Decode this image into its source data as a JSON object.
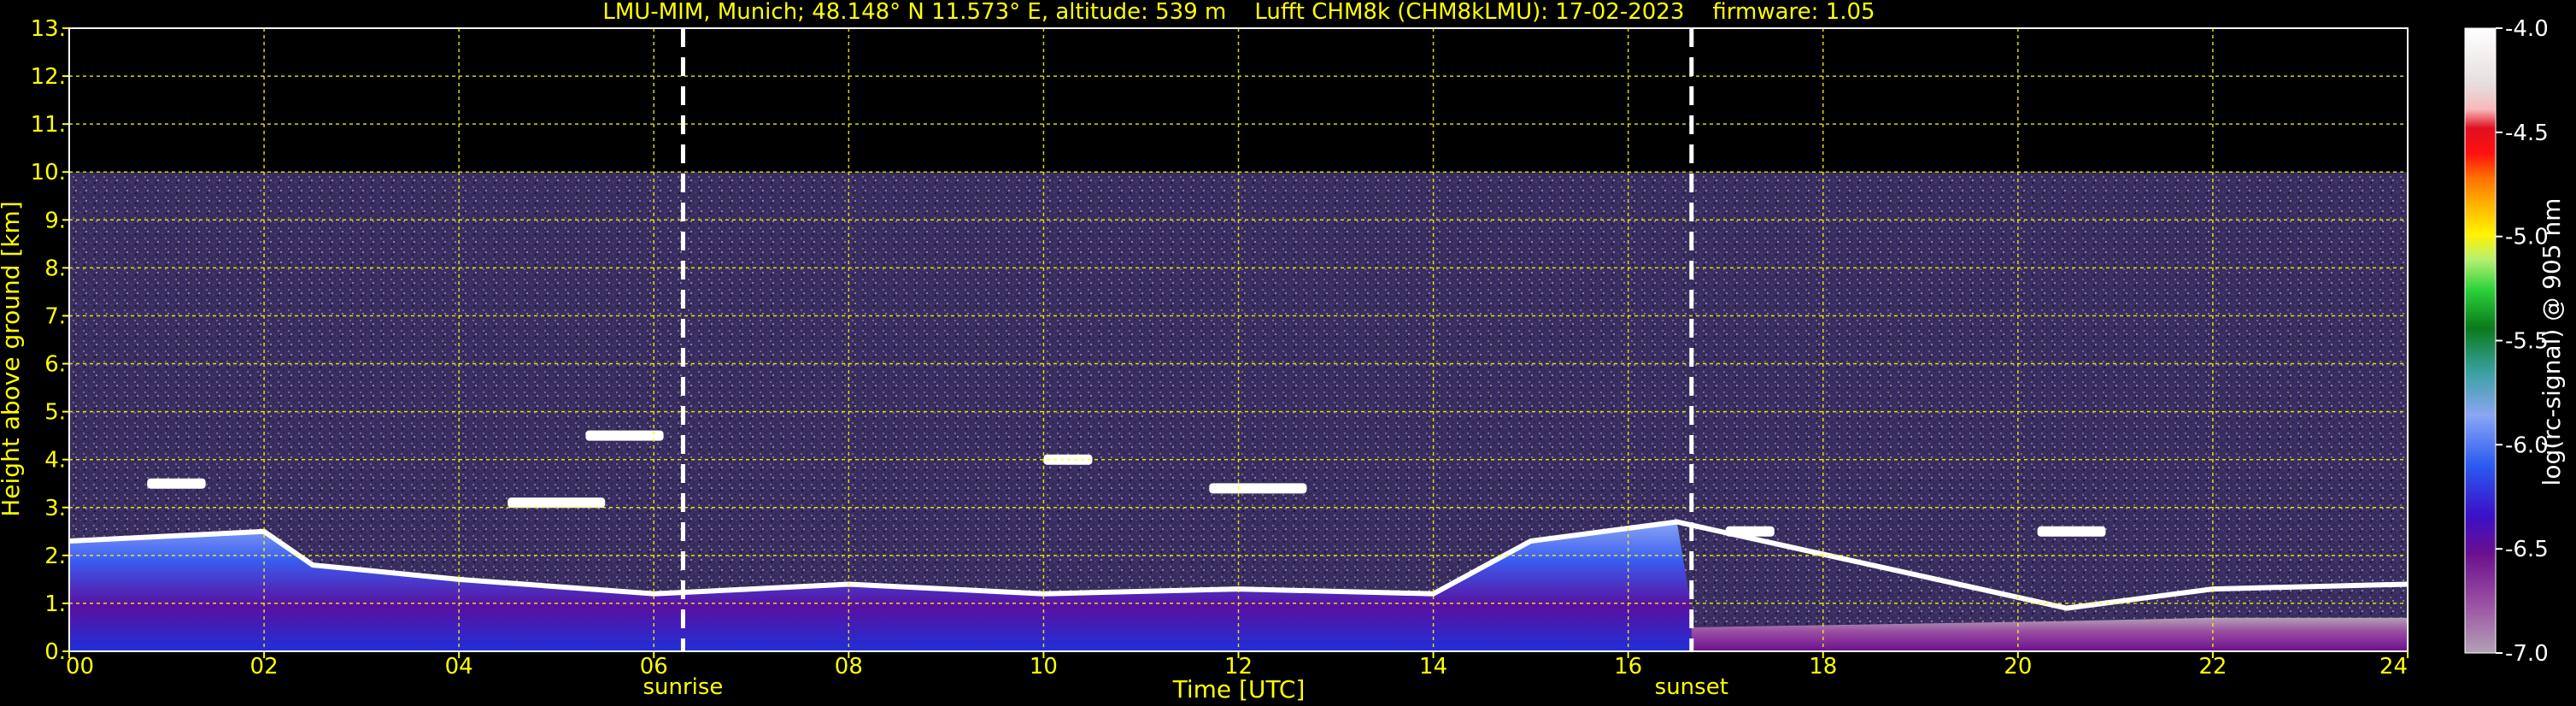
{
  "chart_data": {
    "type": "heatmap",
    "title": "LMU-MIM, Munich; 48.148° N 11.573° E, altitude: 539 m    Lufft CHM8k (CHM8kLMU): 17-02-2023    firmware: 1.05",
    "xlabel": "Time [UTC]",
    "ylabel": "Height above ground [km]",
    "xlim": [
      0,
      24
    ],
    "ylim": [
      0,
      13
    ],
    "x_ticks": [
      "00",
      "02",
      "04",
      "06",
      "08",
      "10",
      "12",
      "14",
      "16",
      "18",
      "20",
      "22",
      "24"
    ],
    "y_ticks": [
      "0.",
      "1.",
      "2.",
      "3.",
      "4.",
      "5.",
      "6.",
      "7.",
      "8.",
      "9.",
      "10.",
      "11.",
      "12.",
      "13."
    ],
    "grid": true,
    "measurement_top_km": 10,
    "markers": [
      {
        "label": "sunrise",
        "time": 6.3
      },
      {
        "label": "sunset",
        "time": 16.65
      }
    ],
    "colorbar": {
      "label": "log(rc-signal) @ 905 nm",
      "range": [
        -7.0,
        -4.0
      ],
      "ticks": [
        "-4.0",
        "-4.5",
        "-5.0",
        "-5.5",
        "-6.0",
        "-6.5",
        "-7.0"
      ]
    },
    "boundary_layer_top_km": [
      {
        "time": 0.0,
        "height": 2.3
      },
      {
        "time": 1.0,
        "height": 2.4
      },
      {
        "time": 2.0,
        "height": 2.5
      },
      {
        "time": 2.5,
        "height": 1.8
      },
      {
        "time": 4.0,
        "height": 1.5
      },
      {
        "time": 6.0,
        "height": 1.2
      },
      {
        "time": 8.0,
        "height": 1.4
      },
      {
        "time": 10.0,
        "height": 1.2
      },
      {
        "time": 12.0,
        "height": 1.3
      },
      {
        "time": 14.0,
        "height": 1.2
      },
      {
        "time": 15.0,
        "height": 2.3
      },
      {
        "time": 16.5,
        "height": 2.7
      },
      {
        "time": 20.5,
        "height": 0.9
      },
      {
        "time": 22.0,
        "height": 1.3
      },
      {
        "time": 24.0,
        "height": 1.4
      }
    ],
    "cloud_layers_km": [
      {
        "time_start": 0.8,
        "time_end": 1.4,
        "height": 3.5
      },
      {
        "time_start": 4.5,
        "time_end": 5.5,
        "height": 3.1
      },
      {
        "time_start": 5.3,
        "time_end": 6.1,
        "height": 4.5
      },
      {
        "time_start": 10.0,
        "time_end": 10.5,
        "height": 4.0
      },
      {
        "time_start": 11.7,
        "time_end": 12.7,
        "height": 3.4
      },
      {
        "time_start": 17.0,
        "time_end": 17.5,
        "height": 2.5
      },
      {
        "time_start": 20.2,
        "time_end": 20.9,
        "height": 2.5
      }
    ]
  }
}
